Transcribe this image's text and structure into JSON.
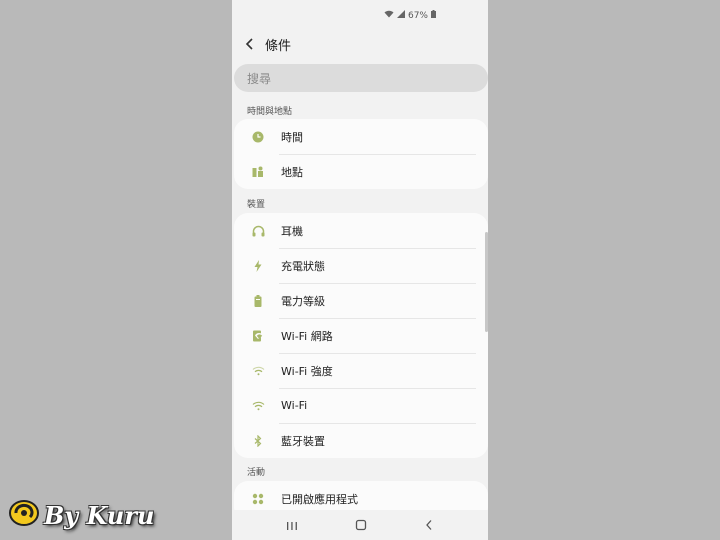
{
  "status_bar": {
    "battery": "67%"
  },
  "header": {
    "title": "條件"
  },
  "search": {
    "placeholder": "搜尋"
  },
  "sections": {
    "time_location": {
      "label": "時間與地點",
      "items": [
        {
          "label": "時間",
          "icon": "clock-icon"
        },
        {
          "label": "地點",
          "icon": "location-icon"
        }
      ]
    },
    "device": {
      "label": "裝置",
      "items": [
        {
          "label": "耳機",
          "icon": "headphones-icon"
        },
        {
          "label": "充電狀態",
          "icon": "charging-icon"
        },
        {
          "label": "電力等級",
          "icon": "battery-icon"
        },
        {
          "label": "Wi-Fi 網路",
          "icon": "wifi-network-icon"
        },
        {
          "label": "Wi-Fi 強度",
          "icon": "wifi-strength-icon"
        },
        {
          "label": "Wi-Fi",
          "icon": "wifi-icon"
        },
        {
          "label": "藍牙裝置",
          "icon": "bluetooth-icon"
        }
      ]
    },
    "activity": {
      "label": "活動",
      "items": [
        {
          "label": "已開啟應用程式",
          "icon": "apps-icon"
        }
      ]
    }
  },
  "watermark": {
    "text": "By Kuru"
  },
  "colors": {
    "accent": "#a8b86a",
    "background": "#f2f2f2",
    "card": "#fbfbfb"
  }
}
